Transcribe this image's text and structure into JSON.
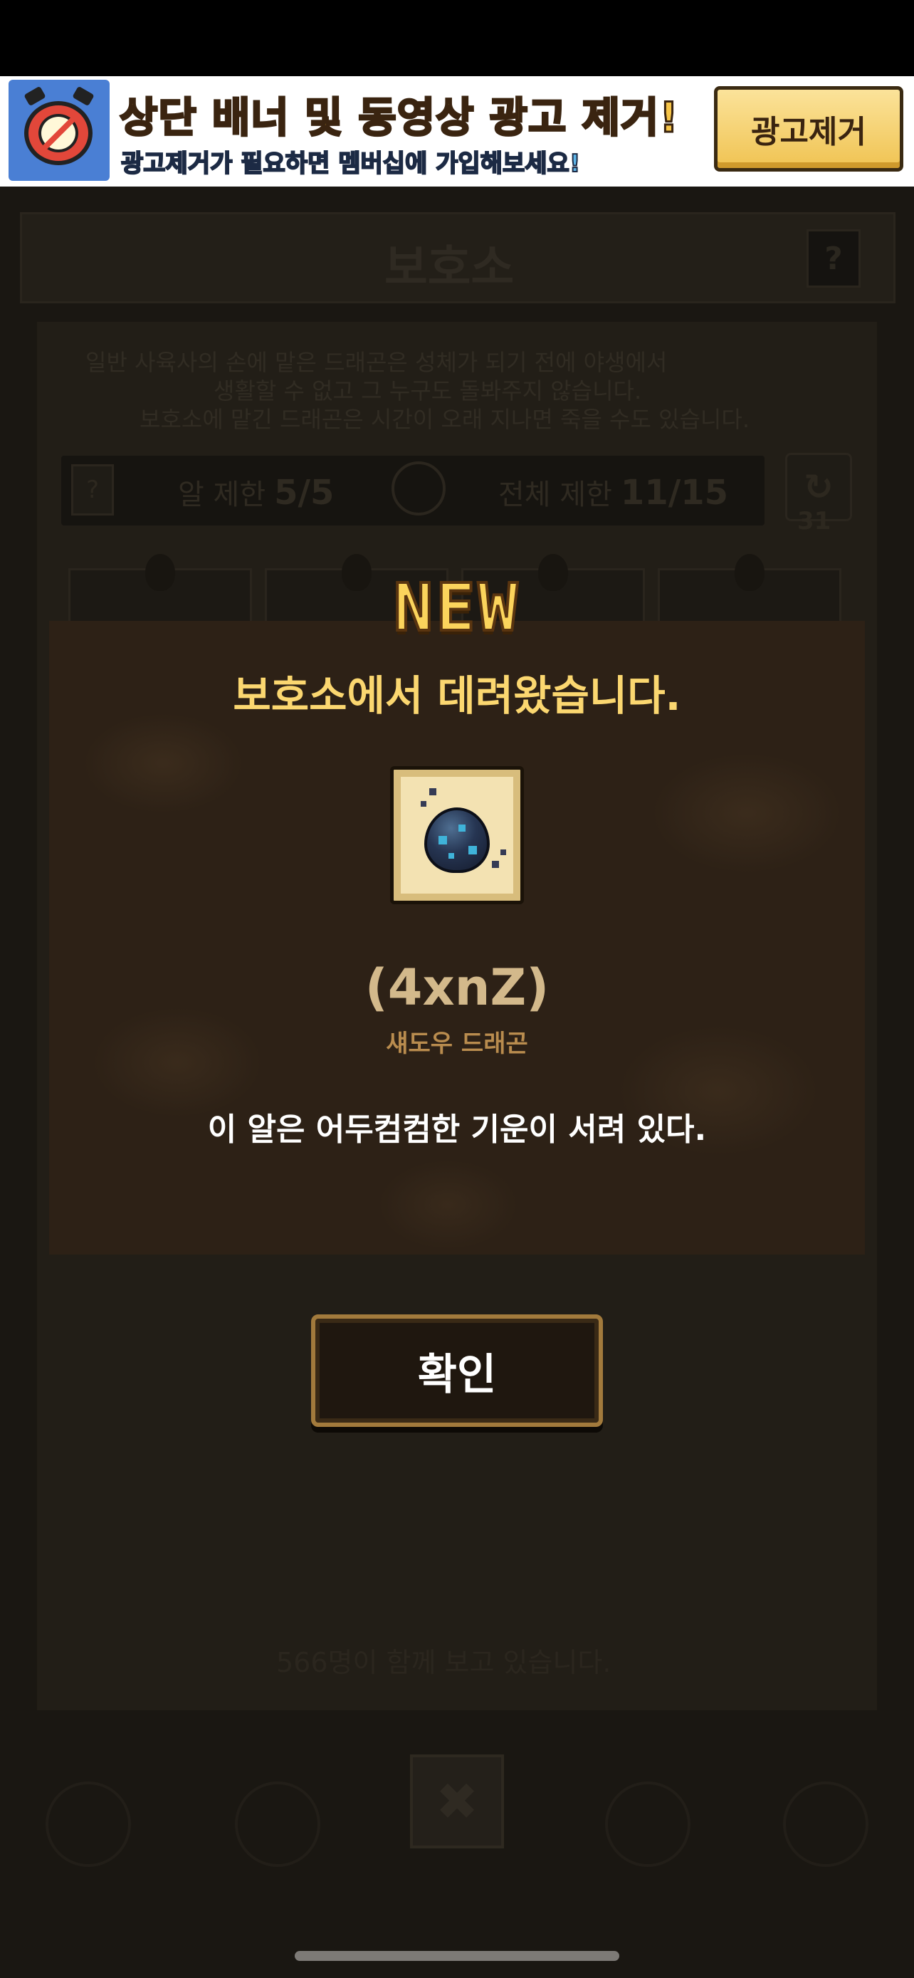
{
  "ad_banner": {
    "title": "상단 배너 및 동영상 광고 제거!",
    "subtitle": "광고제거가 필요하면 멤버십에 가입해보세요!",
    "remove_button_label": "광고제거",
    "icon": "no-ads-alarm-clock-icon"
  },
  "background_screen": {
    "title": "보호소",
    "help_label": "?",
    "description_lines": [
      "일반 사육사의 손에 맡은 드래곤은 성체가 되기 전에 야생에서",
      "생활할 수 없고 그 누구도 돌봐주지 않습니다.",
      "보호소에 맡긴 드래곤은 시간이 오래 지나면 죽을 수도 있습니다."
    ],
    "egg_limit_label": "알 제한",
    "egg_limit_value": "5/5",
    "total_limit_label": "전체 제한",
    "total_limit_value": "11/15",
    "refresh_count": "31",
    "watchers_text": "566명이 함께 보고 있습니다.",
    "close_label": "✖"
  },
  "modal": {
    "badge": "NEW",
    "title": "보호소에서 데려왔습니다.",
    "egg_icon": "shadow-dragon-egg-icon",
    "dragon_name": "(4xnZ)",
    "dragon_type": "섀도우 드래곤",
    "description": "이 알은 어두컴컴한 기운이 서려 있다.",
    "confirm_label": "확인"
  },
  "colors": {
    "accent_gold": "#fbd770",
    "name_beige": "#d3b98b",
    "type_brown": "#b98c4e",
    "modal_bg": "#2d2116"
  }
}
